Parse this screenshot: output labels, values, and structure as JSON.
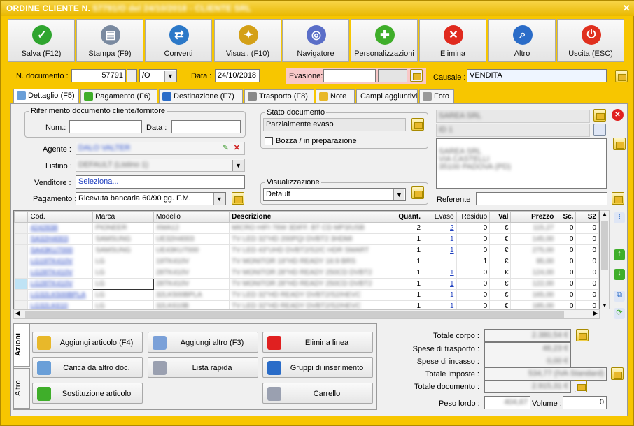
{
  "window": {
    "title": "ORDINE CLIENTE N. 57791 / O del 24/10/2018 - CLIENTE SRL",
    "title_visible": "ORDINE CLIENTE N.",
    "title_blurred": "57791/O del 24/10/2018 - CLIENTE SRL"
  },
  "toolbar": [
    {
      "label": "Salva (F12)",
      "icon": "check-icon",
      "color": "#2fa52f"
    },
    {
      "label": "Stampa (F9)",
      "icon": "printer-icon",
      "color": "#7a8aa0"
    },
    {
      "label": "Converti",
      "icon": "convert-icon",
      "color": "#2b78c8"
    },
    {
      "label": "Visual. (F10)",
      "icon": "wand-icon",
      "color": "#d4a017"
    },
    {
      "label": "Navigatore",
      "icon": "compass-icon",
      "color": "#5a6ec8"
    },
    {
      "label": "Personalizzazioni",
      "icon": "puzzle-icon",
      "color": "#3fae2a"
    },
    {
      "label": "Elimina",
      "icon": "delete-x-icon",
      "color": "#e02a1e"
    },
    {
      "label": "Altro",
      "icon": "search-doc-icon",
      "color": "#2a6cc8"
    },
    {
      "label": "Uscita (ESC)",
      "icon": "power-icon",
      "color": "#e0301e"
    }
  ],
  "doc": {
    "num_label": "N. documento :",
    "num": "57791",
    "series": "/O",
    "date_label": "Data :",
    "date": "24/10/2018",
    "evasione_label": "Evasione:",
    "evasione": "",
    "causale_label": "Causale :",
    "causale": "VENDITA"
  },
  "tabs": [
    "Dettaglio (F5)",
    "Pagamento (F6)",
    "Destinazione (F7)",
    "Trasporto (F8)",
    "Note",
    "Campi aggiuntivi",
    "Foto"
  ],
  "ref": {
    "legend": "Riferimento documento cliente/fornitore",
    "num_label": "Num.:",
    "num": "",
    "data_label": "Data :",
    "data": ""
  },
  "fields": {
    "agente_label": "Agente :",
    "agente": "DALO VALTER",
    "listino_label": "Listino :",
    "listino": "DEFAULT (Listino 1)",
    "venditore_label": "Venditore :",
    "venditore": "Seleziona...",
    "pagamento_label": "Pagamento :",
    "pagamento": "Ricevuta bancaria 60/90 gg. F.M."
  },
  "stato": {
    "legend": "Stato documento",
    "value": "Parzialmente evaso",
    "bozza_label": "Bozza / in preparazione"
  },
  "visual": {
    "legend": "Visualizzazione",
    "value": "Default"
  },
  "cliente": {
    "name": "SAREA SRL",
    "code": "ID 1",
    "address": "SAREA SRL\nVIA CASTELLI\n35100 PADOVA (PD)",
    "referente_label": "Referente",
    "referente": ""
  },
  "grid": {
    "headers": [
      "Cod.",
      "Marca",
      "Modello",
      "Descrizione",
      "Quant.",
      "Evaso",
      "Residuo",
      "Val",
      "Prezzo",
      "Sc.",
      "S2"
    ],
    "rows": [
      [
        "4242838",
        "PIONEER",
        "XMA12",
        "MICRO HIFI 76W 3DIFF. BT CD MP3/USB",
        "2",
        "2",
        "0",
        "€",
        "115,27",
        "0",
        "0"
      ],
      [
        "SA32H4003",
        "SAMSUNG",
        "UE32H4003",
        "TV LED 32\"HD 200PQI DVBT2 3HDMI",
        "1",
        "1",
        "0",
        "€",
        "145,00",
        "0",
        "0"
      ],
      [
        "SA43KU7000",
        "SAMSUNG",
        "UE43KU7000",
        "TV LED 43\"UHD DVBT2/S2/C HDR SMART",
        "1",
        "1",
        "0",
        "€",
        "275,00",
        "0",
        "0"
      ],
      [
        "LG19TK410V",
        "LG",
        "19TK410V",
        "TV MONITOR 19\"HD READY 16:9 BRS",
        "1",
        "",
        "1",
        "€",
        "95,00",
        "0",
        "0"
      ],
      [
        "LG28TK410V",
        "LG",
        "28TK410V",
        "TV MONITOR 28\"HD READY 250CD DVBT2",
        "1",
        "1",
        "0",
        "€",
        "124,00",
        "0",
        "0"
      ],
      [
        "LG28TK410V",
        "LG",
        "28TK410V",
        "TV MONITOR 28\"HD READY 250CD DVBT2",
        "1",
        "1",
        "0",
        "€",
        "122,00",
        "0",
        "0"
      ],
      [
        "LG32LK500BPLA",
        "LG",
        "32LK500BPLA",
        "TV LED 32\"HD READY DVBT2/S2/HEVC",
        "1",
        "1",
        "0",
        "€",
        "165,00",
        "0",
        "0"
      ],
      [
        "LG32LK610",
        "LG",
        "32LK610B",
        "TV LED 32\"HD READY DVBT2/S2/HEVC",
        "1",
        "1",
        "0",
        "€",
        "185,00",
        "0",
        "0"
      ]
    ]
  },
  "vtabs": [
    "Azioni",
    "Altro"
  ],
  "actions": [
    {
      "label": "Aggiungi articolo (F4)",
      "icon": "add-article-icon"
    },
    {
      "label": "Aggiungi altro (F3)",
      "icon": "add-other-icon"
    },
    {
      "label": "Elimina linea",
      "icon": "delete-line-icon"
    },
    {
      "label": "Carica da altro doc.",
      "icon": "load-doc-icon"
    },
    {
      "label": "Lista rapida",
      "icon": "quick-list-icon"
    },
    {
      "label": "Gruppi di inserimento",
      "icon": "insert-group-icon"
    },
    {
      "label": "Sostituzione articolo",
      "icon": "replace-article-icon"
    },
    {
      "label": "Carrello",
      "icon": "cart-icon"
    }
  ],
  "totals": {
    "corpo_label": "Totale corpo :",
    "corpo": "2.380,54 €",
    "trasporto_label": "Spese di trasporto :",
    "trasporto": "46,23 €",
    "incasso_label": "Spese di incasso :",
    "incasso": "0,00 €",
    "imposte_label": "Totale imposte :",
    "imposte": "534,77 (IVA Standard)",
    "imposte_suffix": "Standard",
    "documento_label": "Totale documento :",
    "documento": "2.915,31 €",
    "peso_label": "Peso lordo :",
    "peso": "404,67",
    "volume_label": "Volume :",
    "volume": "0"
  }
}
